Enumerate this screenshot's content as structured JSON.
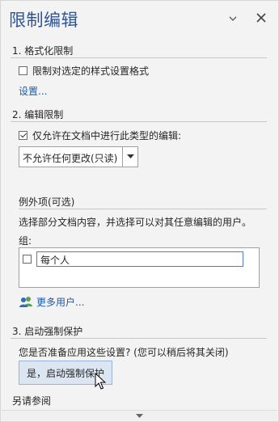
{
  "pane": {
    "title": "限制编辑"
  },
  "section1": {
    "heading": "1. 格式化限制",
    "checkbox_label": "限制对选定的样式设置格式",
    "checked": false,
    "settings_link": "设置..."
  },
  "section2": {
    "heading": "2. 编辑限制",
    "checkbox_label": "仅允许在文档中进行此类型的编辑:",
    "checked": true,
    "select_value": "不允许任何更改(只读)",
    "exceptions_heading": "例外项(可选)",
    "exceptions_desc": "选择部分文档内容，并选择可以对其任意编辑的用户。",
    "groups_label": "组:",
    "users": [
      {
        "name": "每个人",
        "checked": false
      }
    ],
    "more_users_link": "更多用户..."
  },
  "section3": {
    "heading": "3. 启动强制保护",
    "question": "您是否准备应用这些设置? (您可以稍后将其关闭)",
    "enforce_button": "是，启动强制保护"
  },
  "see_also": "另请参阅",
  "colors": {
    "title": "#2b579a",
    "link": "#1e5aa8",
    "button_bg": "#dce6f2"
  }
}
